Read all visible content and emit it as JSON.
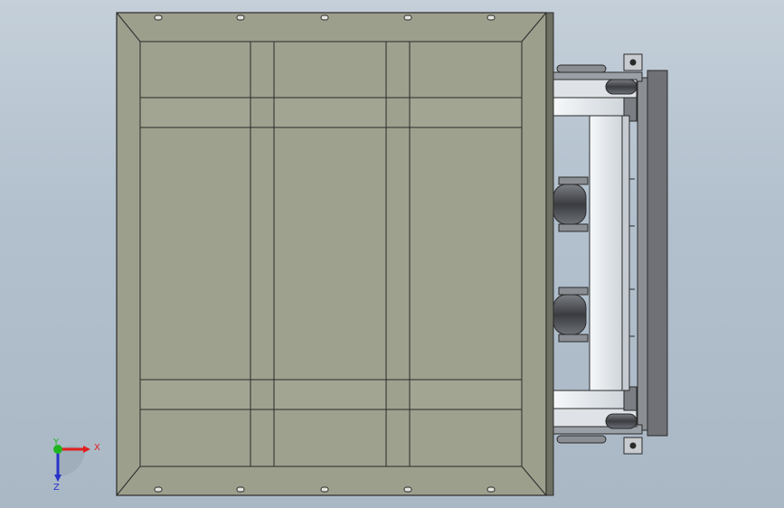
{
  "viewport": {
    "background_top": "#c4cfd9",
    "background_bottom": "#aab8c6"
  },
  "model": {
    "panel_color": "#9c9f8c",
    "edge_color": "#2a2a2a",
    "rail_color": "#e8ecef",
    "roller_color": "#5a5d61"
  },
  "triad": {
    "x_label": "X",
    "y_label": "Y",
    "z_label": "Z",
    "x_color": "#e0201e",
    "y_color": "#1fb51f",
    "z_color": "#2833c8"
  }
}
